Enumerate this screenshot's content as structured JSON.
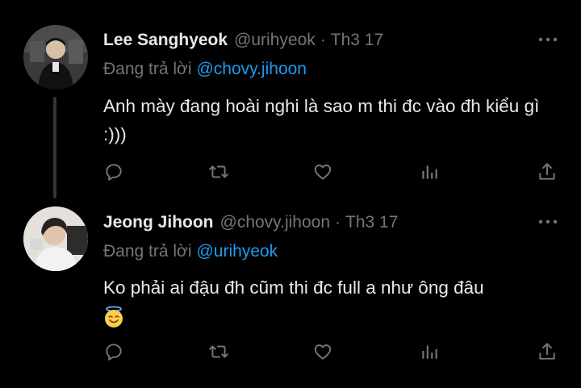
{
  "tweets": [
    {
      "author_name": "Lee Sanghyeok",
      "handle": "@urihyeok",
      "separator": "·",
      "date": "Th3 17",
      "reply_prefix": "Đang trả lời",
      "reply_to": "@chovy.jihoon",
      "text": "Anh mày đang hoài nghi là sao m thi đc vào đh kiểu gì :)))",
      "avatar": "avatar-lee-sanghyeok"
    },
    {
      "author_name": "Jeong Jihoon",
      "handle": "@chovy.jihoon",
      "separator": "·",
      "date": "Th3 17",
      "reply_prefix": "Đang trả lời",
      "reply_to": "@urihyeok",
      "text": "Ko phải ai đậu đh cũm thi đc full a như ông đâu",
      "emoji": "smiling-face-with-halo",
      "avatar": "avatar-jeong-jihoon"
    }
  ],
  "icons": {
    "more": "more-horizontal-icon",
    "reply": "reply-icon",
    "retweet": "retweet-icon",
    "like": "heart-icon",
    "views": "views-bar-chart-icon",
    "share": "share-icon"
  },
  "colors": {
    "background": "#000000",
    "text_primary": "#e7e9ea",
    "text_secondary": "#71767b",
    "accent": "#1d9bf0",
    "thread_line": "#333639"
  }
}
